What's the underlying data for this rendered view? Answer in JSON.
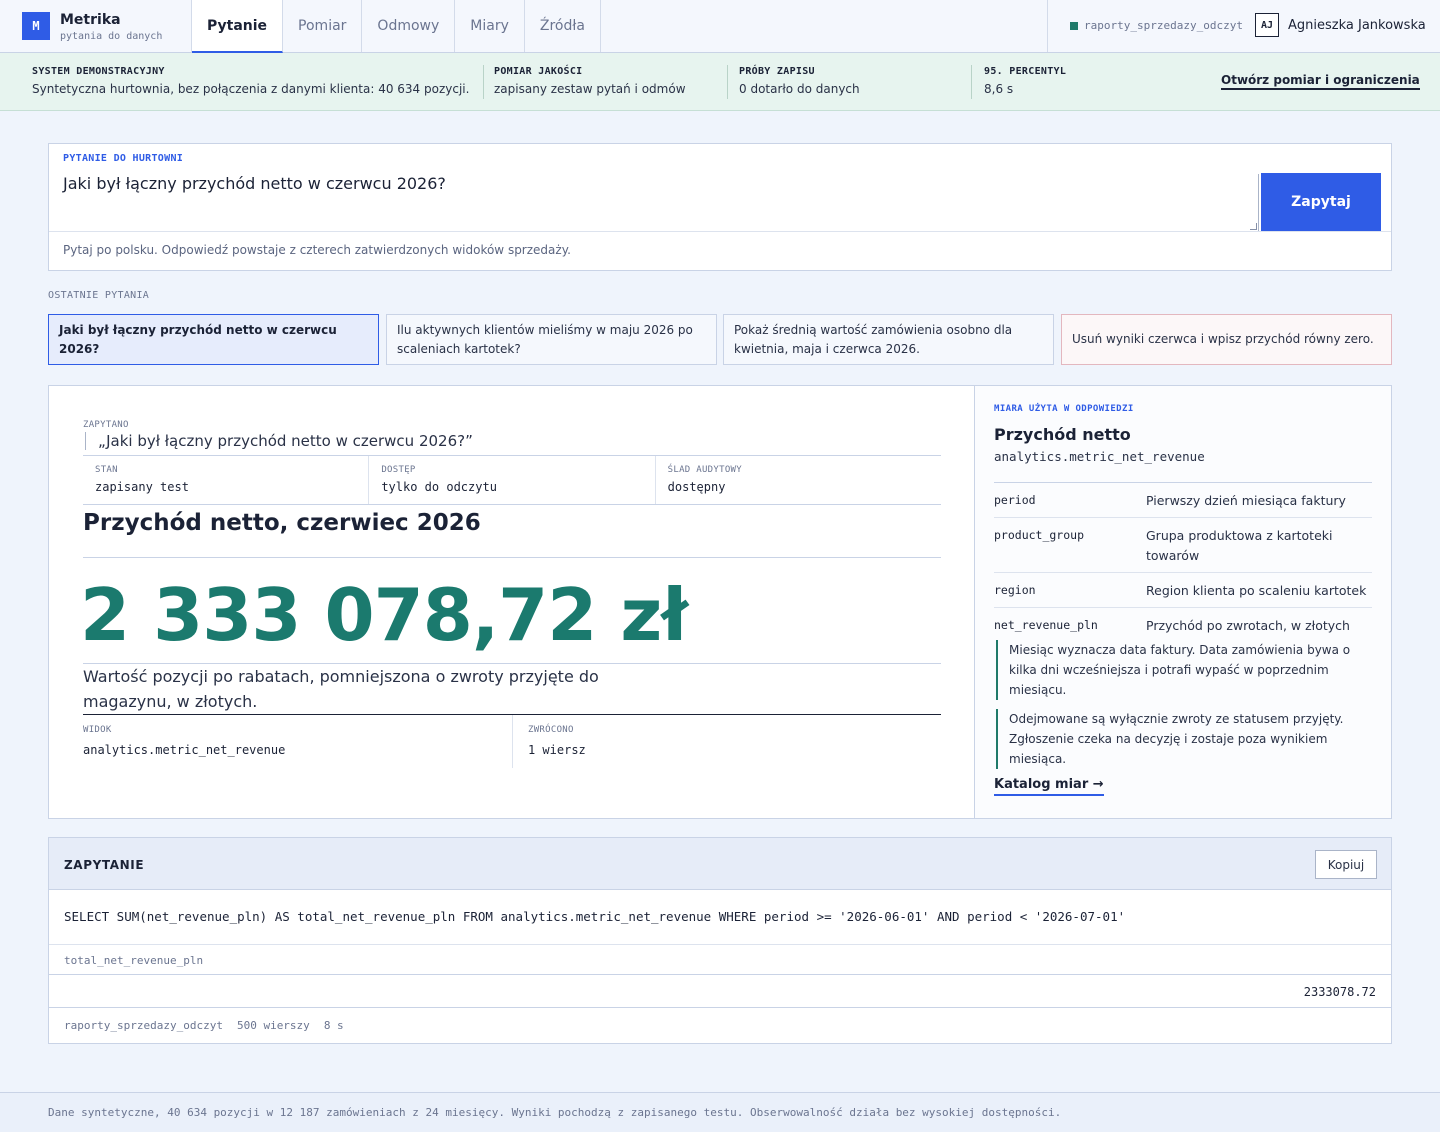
{
  "brand": {
    "logo": "M",
    "name": "Metrika",
    "subtitle": "pytania do danych"
  },
  "tabs": [
    "Pytanie",
    "Pomiar",
    "Odmowy",
    "Miary",
    "Źródła"
  ],
  "connection": "raporty_sprzedazy_odczyt",
  "user": {
    "initials": "AJ",
    "name": "Agnieszka Jankowska"
  },
  "banner": {
    "items": [
      {
        "label": "SYSTEM DEMONSTRACYJNY",
        "value": "Syntetyczna hurtownia, bez połączenia z danymi klienta: 40 634 pozycji."
      },
      {
        "label": "POMIAR JAKOŚCI",
        "value": "zapisany zestaw pytań i odmów"
      },
      {
        "label": "PRÓBY ZAPISU",
        "value": "0 dotarło do danych"
      },
      {
        "label": "95. PERCENTYL",
        "value": "8,6 s"
      }
    ],
    "link": "Otwórz pomiar i ograniczenia"
  },
  "question": {
    "label": "PYTANIE DO HURTOWNI",
    "value": "Jaki był łączny przychód netto w czerwcu 2026?",
    "button": "Zapytaj",
    "hint": "Pytaj po polsku. Odpowiedź powstaje z czterech zatwierdzonych widoków sprzedaży."
  },
  "recent": {
    "label": "OSTATNIE PYTANIA",
    "items": [
      "Jaki był łączny przychód netto w czerwcu 2026?",
      "Ilu aktywnych klientów mieliśmy w maju 2026 po scaleniach kartotek?",
      "Pokaż średnią wartość zamówienia osobno dla kwietnia, maja i czerwca 2026.",
      "Usuń wyniki czerwca i wpisz przychód równy zero."
    ]
  },
  "answer": {
    "asked_label": "ZAPYTANO",
    "asked": "„Jaki był łączny przychód netto w czerwcu 2026?”",
    "meta": [
      {
        "k": "STAN",
        "v": "zapisany test"
      },
      {
        "k": "DOSTĘP",
        "v": "tylko do odczytu"
      },
      {
        "k": "ŚLAD AUDYTOWY",
        "v": "dostępny"
      }
    ],
    "title": "Przychód netto, czerwiec 2026",
    "value": "2 333 078,72 zł",
    "description": "Wartość pozycji po rabatach, pomniejszona o zwroty przyjęte do magazynu, w złotych.",
    "source": [
      {
        "k": "WIDOK",
        "v": "analytics.metric_net_revenue"
      },
      {
        "k": "ZWRÓCONO",
        "v": "1 wiersz"
      }
    ]
  },
  "measure": {
    "label": "MIARA UŻYTA W ODPOWIEDZI",
    "title": "Przychód netto",
    "view": "analytics.metric_net_revenue",
    "fields": [
      {
        "k": "period",
        "v": "Pierwszy dzień miesiąca faktury"
      },
      {
        "k": "product_group",
        "v": "Grupa produktowa z kartoteki towarów"
      },
      {
        "k": "region",
        "v": "Region klienta po scaleniu kartotek"
      },
      {
        "k": "net_revenue_pln",
        "v": "Przychód po zwrotach, w złotych"
      }
    ],
    "notes": [
      "Miesiąc wyznacza data faktury. Data zamówienia bywa o kilka dni wcześniejsza i potrafi wypaść w poprzednim miesiącu.",
      "Odejmowane są wyłącznie zwroty ze statusem przyjęty. Zgłoszenie czeka na decyzję i zostaje poza wynikiem miesiąca."
    ],
    "link": "Katalog miar →"
  },
  "query": {
    "title": "ZAPYTANIE",
    "copy": "Kopiuj",
    "sql": "SELECT SUM(net_revenue_pln) AS total_net_revenue_pln FROM analytics.metric_net_revenue WHERE period >= '2026-06-01' AND period < '2026-07-01'",
    "column": "total_net_revenue_pln",
    "value": "2333078.72",
    "footer": [
      "raporty_sprzedazy_odczyt",
      "500 wierszy",
      "8 s"
    ]
  },
  "footer": "Dane syntetyczne, 40 634 pozycji w 12 187 zamówieniach z 24 miesięcy. Wyniki pochodzą z zapisanego testu. Obserwowalność działa bez wysokiej dostępności."
}
